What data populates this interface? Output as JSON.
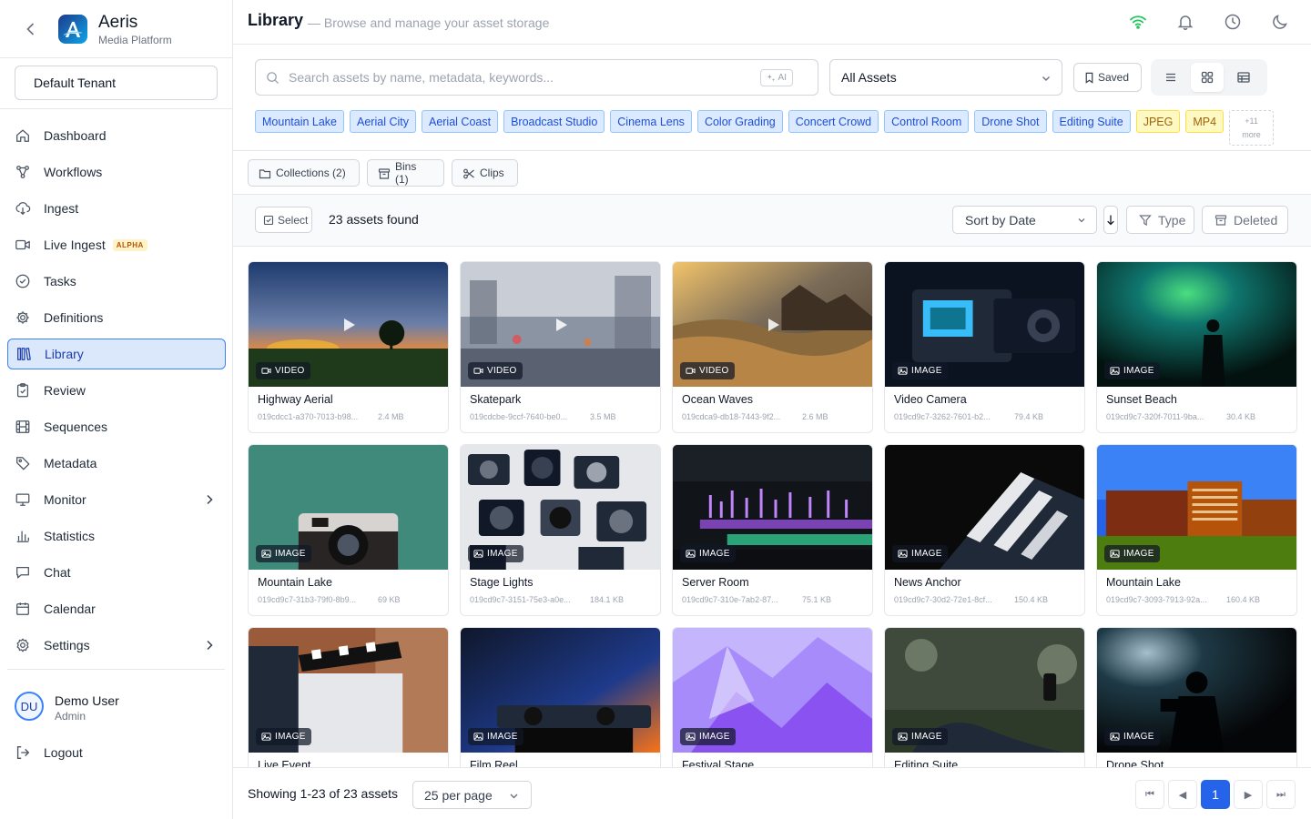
{
  "brand": {
    "name": "Aeris",
    "subtitle": "Media Platform"
  },
  "tenant": "Default Tenant",
  "nav": [
    {
      "label": "Dashboard",
      "icon": "home-icon"
    },
    {
      "label": "Workflows",
      "icon": "workflow-icon"
    },
    {
      "label": "Ingest",
      "icon": "cloud-download-icon"
    },
    {
      "label": "Live Ingest",
      "icon": "video-icon",
      "badge": "ALPHA"
    },
    {
      "label": "Tasks",
      "icon": "check-circle-icon"
    },
    {
      "label": "Definitions",
      "icon": "gear-icon"
    },
    {
      "label": "Library",
      "icon": "library-icon",
      "active": true
    },
    {
      "label": "Review",
      "icon": "clipboard-check-icon"
    },
    {
      "label": "Sequences",
      "icon": "film-icon"
    },
    {
      "label": "Metadata",
      "icon": "tag-icon"
    },
    {
      "label": "Monitor",
      "icon": "monitor-icon",
      "expandable": true
    },
    {
      "label": "Statistics",
      "icon": "bar-chart-icon"
    },
    {
      "label": "Chat",
      "icon": "chat-icon"
    },
    {
      "label": "Calendar",
      "icon": "calendar-icon"
    },
    {
      "label": "Settings",
      "icon": "settings-icon",
      "expandable": true
    }
  ],
  "user": {
    "initials": "DU",
    "name": "Demo User",
    "role": "Admin"
  },
  "logout_label": "Logout",
  "header": {
    "title": "Library",
    "subtitle": "— Browse and manage your asset storage"
  },
  "search": {
    "placeholder": "Search assets by name, metadata, keywords...",
    "ai_label": "AI"
  },
  "asset_filter": "All Assets",
  "saved_label": "Saved",
  "tags": [
    {
      "label": "Mountain Lake",
      "color": "blue"
    },
    {
      "label": "Aerial City",
      "color": "blue"
    },
    {
      "label": "Aerial Coast",
      "color": "blue"
    },
    {
      "label": "Broadcast Studio",
      "color": "blue"
    },
    {
      "label": "Cinema Lens",
      "color": "blue"
    },
    {
      "label": "Color Grading",
      "color": "blue"
    },
    {
      "label": "Concert Crowd",
      "color": "blue"
    },
    {
      "label": "Control Room",
      "color": "blue"
    },
    {
      "label": "Drone Shot",
      "color": "blue"
    },
    {
      "label": "Editing Suite",
      "color": "blue"
    },
    {
      "label": "JPEG",
      "color": "yellow"
    },
    {
      "label": "MP4",
      "color": "yellow"
    }
  ],
  "tags_more": {
    "count": "+11",
    "label": "more"
  },
  "subtabs": {
    "collections": "Collections (2)",
    "bins": "Bins (1)",
    "clips": "Clips"
  },
  "toolbar": {
    "select_label": "Select",
    "count": "23 assets found",
    "sort_label": "Sort by Date",
    "type_label": "Type",
    "deleted_label": "Deleted"
  },
  "assets": [
    {
      "name": "Highway Aerial",
      "type": "VIDEO",
      "id": "019cdcc1-a370-7013-b98...",
      "size": "2.4 MB",
      "scene": "sunset"
    },
    {
      "name": "Skatepark",
      "type": "VIDEO",
      "id": "019cdcbe-9ccf-7640-be0...",
      "size": "3.5 MB",
      "scene": "street"
    },
    {
      "name": "Ocean Waves",
      "type": "VIDEO",
      "id": "019cdca9-db18-7443-9f2...",
      "size": "2.6 MB",
      "scene": "ocean"
    },
    {
      "name": "Video Camera",
      "type": "IMAGE",
      "id": "019cd9c7-3262-7601-b2...",
      "size": "79.4 KB",
      "scene": "camera"
    },
    {
      "name": "Sunset Beach",
      "type": "IMAGE",
      "id": "019cd9c7-320f-7011-9ba...",
      "size": "30.4 KB",
      "scene": "silhouette"
    },
    {
      "name": "Mountain Lake",
      "type": "IMAGE",
      "id": "019cd9c7-31b3-79f0-8b9...",
      "size": "69 KB",
      "scene": "vintage"
    },
    {
      "name": "Stage Lights",
      "type": "IMAGE",
      "id": "019cd9c7-3151-75e3-a0e...",
      "size": "184.1 KB",
      "scene": "cameras"
    },
    {
      "name": "Server Room",
      "type": "IMAGE",
      "id": "019cd9c7-310e-7ab2-87...",
      "size": "75.1 KB",
      "scene": "editor"
    },
    {
      "name": "News Anchor",
      "type": "IMAGE",
      "id": "019cd9c7-30d2-72e1-8cf...",
      "size": "150.4 KB",
      "scene": "clapper"
    },
    {
      "name": "Mountain Lake",
      "type": "IMAGE",
      "id": "019cd9c7-3093-7913-92a...",
      "size": "160.4 KB",
      "scene": "building"
    },
    {
      "name": "Live Event",
      "type": "IMAGE",
      "id": "",
      "size": "",
      "scene": "director"
    },
    {
      "name": "Film Reel",
      "type": "IMAGE",
      "id": "",
      "size": "",
      "scene": "reel"
    },
    {
      "name": "Festival Stage",
      "type": "IMAGE",
      "id": "",
      "size": "",
      "scene": "crystal"
    },
    {
      "name": "Editing Suite",
      "type": "IMAGE",
      "id": "",
      "size": "",
      "scene": "bokeh"
    },
    {
      "name": "Drone Shot",
      "type": "IMAGE",
      "id": "",
      "size": "",
      "scene": "dark"
    }
  ],
  "footer": {
    "showing": "Showing 1-23 of 23 assets",
    "per_page": "25 per page",
    "current_page": "1"
  }
}
